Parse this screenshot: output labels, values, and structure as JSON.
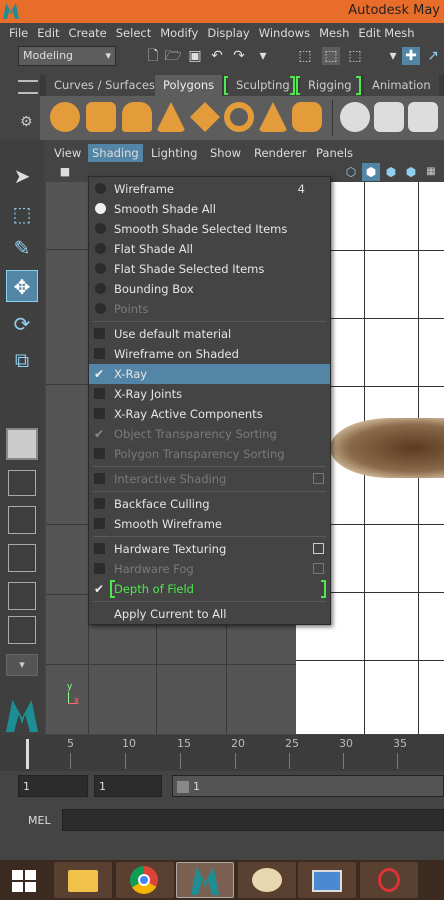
{
  "window": {
    "title": "Autodesk May"
  },
  "menubar": [
    "File",
    "Edit",
    "Create",
    "Select",
    "Modify",
    "Display",
    "Windows",
    "Mesh",
    "Edit Mesh"
  ],
  "toolbar": {
    "mode": "Modeling"
  },
  "shelf_tabs": [
    "Curves / Surfaces",
    "Polygons",
    "Sculpting",
    "Rigging",
    "Animation"
  ],
  "panel_menu": [
    "View",
    "Shading",
    "Lighting",
    "Show",
    "Renderer",
    "Panels"
  ],
  "shading_menu": [
    {
      "label": "Wireframe",
      "hotkey": "4",
      "kind": "radio",
      "on": false,
      "disabled": false
    },
    {
      "label": "Smooth Shade All",
      "hotkey": "",
      "kind": "radio",
      "on": true,
      "disabled": false
    },
    {
      "label": "Smooth Shade Selected Items",
      "hotkey": "",
      "kind": "radio",
      "on": false,
      "disabled": false
    },
    {
      "label": "Flat Shade All",
      "hotkey": "",
      "kind": "radio",
      "on": false,
      "disabled": false
    },
    {
      "label": "Flat Shade Selected Items",
      "hotkey": "",
      "kind": "radio",
      "on": false,
      "disabled": false
    },
    {
      "label": "Bounding Box",
      "hotkey": "",
      "kind": "radio",
      "on": false,
      "disabled": false
    },
    {
      "label": "Points",
      "hotkey": "",
      "kind": "radio",
      "on": false,
      "disabled": true
    },
    {
      "label": "Use default material",
      "kind": "check",
      "on": false,
      "disabled": false
    },
    {
      "label": "Wireframe on Shaded",
      "kind": "check",
      "on": false,
      "disabled": false
    },
    {
      "label": "X-Ray",
      "kind": "check",
      "on": true,
      "disabled": false,
      "highlighted": true
    },
    {
      "label": "X-Ray Joints",
      "kind": "check",
      "on": false,
      "disabled": false
    },
    {
      "label": "X-Ray Active Components",
      "kind": "check",
      "on": false,
      "disabled": false
    },
    {
      "label": "Object Transparency Sorting",
      "kind": "check",
      "on": true,
      "disabled": true
    },
    {
      "label": "Polygon Transparency Sorting",
      "kind": "check",
      "on": false,
      "disabled": true
    },
    {
      "label": "Interactive Shading",
      "kind": "check",
      "on": false,
      "disabled": true,
      "option": true
    },
    {
      "label": "Backface Culling",
      "kind": "check",
      "on": false,
      "disabled": false
    },
    {
      "label": "Smooth Wireframe",
      "kind": "check",
      "on": false,
      "disabled": false
    },
    {
      "label": "Hardware Texturing",
      "kind": "check",
      "on": false,
      "disabled": false,
      "option": true
    },
    {
      "label": "Hardware Fog",
      "kind": "check",
      "on": false,
      "disabled": true,
      "option": true
    },
    {
      "label": "Depth of Field",
      "kind": "check",
      "on": true,
      "disabled": false,
      "green": true
    },
    {
      "label": "Apply Current to All",
      "kind": "plain",
      "on": false,
      "disabled": false
    }
  ],
  "timeline": {
    "ticks": [
      "5",
      "10",
      "15",
      "20",
      "25",
      "30",
      "35"
    ],
    "current": "1"
  },
  "range": {
    "start": "1",
    "anim_start": "1",
    "playback_start": "1"
  },
  "command_line": {
    "mode": "MEL"
  },
  "axis_labels": {
    "x": "x",
    "y": "y"
  },
  "colors": {
    "title_bar": "#e96d2a",
    "highlight": "#5285a6",
    "green_bracket": "#4ee84e"
  }
}
